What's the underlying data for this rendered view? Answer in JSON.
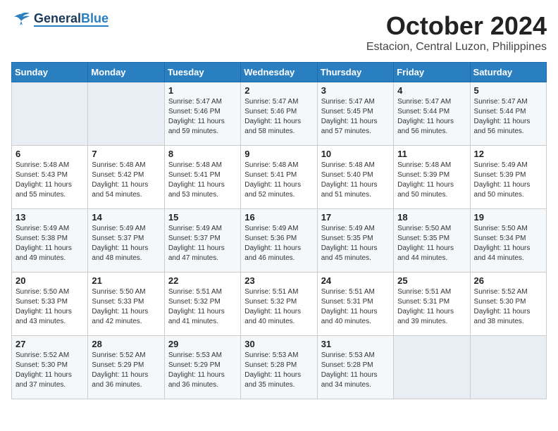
{
  "header": {
    "logo": {
      "general": "General",
      "blue": "Blue"
    },
    "month": "October 2024",
    "location": "Estacion, Central Luzon, Philippines"
  },
  "weekdays": [
    "Sunday",
    "Monday",
    "Tuesday",
    "Wednesday",
    "Thursday",
    "Friday",
    "Saturday"
  ],
  "weeks": [
    [
      {
        "day": "",
        "info": ""
      },
      {
        "day": "",
        "info": ""
      },
      {
        "day": "1",
        "info": "Sunrise: 5:47 AM\nSunset: 5:46 PM\nDaylight: 11 hours and 59 minutes."
      },
      {
        "day": "2",
        "info": "Sunrise: 5:47 AM\nSunset: 5:46 PM\nDaylight: 11 hours and 58 minutes."
      },
      {
        "day": "3",
        "info": "Sunrise: 5:47 AM\nSunset: 5:45 PM\nDaylight: 11 hours and 57 minutes."
      },
      {
        "day": "4",
        "info": "Sunrise: 5:47 AM\nSunset: 5:44 PM\nDaylight: 11 hours and 56 minutes."
      },
      {
        "day": "5",
        "info": "Sunrise: 5:47 AM\nSunset: 5:44 PM\nDaylight: 11 hours and 56 minutes."
      }
    ],
    [
      {
        "day": "6",
        "info": "Sunrise: 5:48 AM\nSunset: 5:43 PM\nDaylight: 11 hours and 55 minutes."
      },
      {
        "day": "7",
        "info": "Sunrise: 5:48 AM\nSunset: 5:42 PM\nDaylight: 11 hours and 54 minutes."
      },
      {
        "day": "8",
        "info": "Sunrise: 5:48 AM\nSunset: 5:41 PM\nDaylight: 11 hours and 53 minutes."
      },
      {
        "day": "9",
        "info": "Sunrise: 5:48 AM\nSunset: 5:41 PM\nDaylight: 11 hours and 52 minutes."
      },
      {
        "day": "10",
        "info": "Sunrise: 5:48 AM\nSunset: 5:40 PM\nDaylight: 11 hours and 51 minutes."
      },
      {
        "day": "11",
        "info": "Sunrise: 5:48 AM\nSunset: 5:39 PM\nDaylight: 11 hours and 50 minutes."
      },
      {
        "day": "12",
        "info": "Sunrise: 5:49 AM\nSunset: 5:39 PM\nDaylight: 11 hours and 50 minutes."
      }
    ],
    [
      {
        "day": "13",
        "info": "Sunrise: 5:49 AM\nSunset: 5:38 PM\nDaylight: 11 hours and 49 minutes."
      },
      {
        "day": "14",
        "info": "Sunrise: 5:49 AM\nSunset: 5:37 PM\nDaylight: 11 hours and 48 minutes."
      },
      {
        "day": "15",
        "info": "Sunrise: 5:49 AM\nSunset: 5:37 PM\nDaylight: 11 hours and 47 minutes."
      },
      {
        "day": "16",
        "info": "Sunrise: 5:49 AM\nSunset: 5:36 PM\nDaylight: 11 hours and 46 minutes."
      },
      {
        "day": "17",
        "info": "Sunrise: 5:49 AM\nSunset: 5:35 PM\nDaylight: 11 hours and 45 minutes."
      },
      {
        "day": "18",
        "info": "Sunrise: 5:50 AM\nSunset: 5:35 PM\nDaylight: 11 hours and 44 minutes."
      },
      {
        "day": "19",
        "info": "Sunrise: 5:50 AM\nSunset: 5:34 PM\nDaylight: 11 hours and 44 minutes."
      }
    ],
    [
      {
        "day": "20",
        "info": "Sunrise: 5:50 AM\nSunset: 5:33 PM\nDaylight: 11 hours and 43 minutes."
      },
      {
        "day": "21",
        "info": "Sunrise: 5:50 AM\nSunset: 5:33 PM\nDaylight: 11 hours and 42 minutes."
      },
      {
        "day": "22",
        "info": "Sunrise: 5:51 AM\nSunset: 5:32 PM\nDaylight: 11 hours and 41 minutes."
      },
      {
        "day": "23",
        "info": "Sunrise: 5:51 AM\nSunset: 5:32 PM\nDaylight: 11 hours and 40 minutes."
      },
      {
        "day": "24",
        "info": "Sunrise: 5:51 AM\nSunset: 5:31 PM\nDaylight: 11 hours and 40 minutes."
      },
      {
        "day": "25",
        "info": "Sunrise: 5:51 AM\nSunset: 5:31 PM\nDaylight: 11 hours and 39 minutes."
      },
      {
        "day": "26",
        "info": "Sunrise: 5:52 AM\nSunset: 5:30 PM\nDaylight: 11 hours and 38 minutes."
      }
    ],
    [
      {
        "day": "27",
        "info": "Sunrise: 5:52 AM\nSunset: 5:30 PM\nDaylight: 11 hours and 37 minutes."
      },
      {
        "day": "28",
        "info": "Sunrise: 5:52 AM\nSunset: 5:29 PM\nDaylight: 11 hours and 36 minutes."
      },
      {
        "day": "29",
        "info": "Sunrise: 5:53 AM\nSunset: 5:29 PM\nDaylight: 11 hours and 36 minutes."
      },
      {
        "day": "30",
        "info": "Sunrise: 5:53 AM\nSunset: 5:28 PM\nDaylight: 11 hours and 35 minutes."
      },
      {
        "day": "31",
        "info": "Sunrise: 5:53 AM\nSunset: 5:28 PM\nDaylight: 11 hours and 34 minutes."
      },
      {
        "day": "",
        "info": ""
      },
      {
        "day": "",
        "info": ""
      }
    ]
  ]
}
